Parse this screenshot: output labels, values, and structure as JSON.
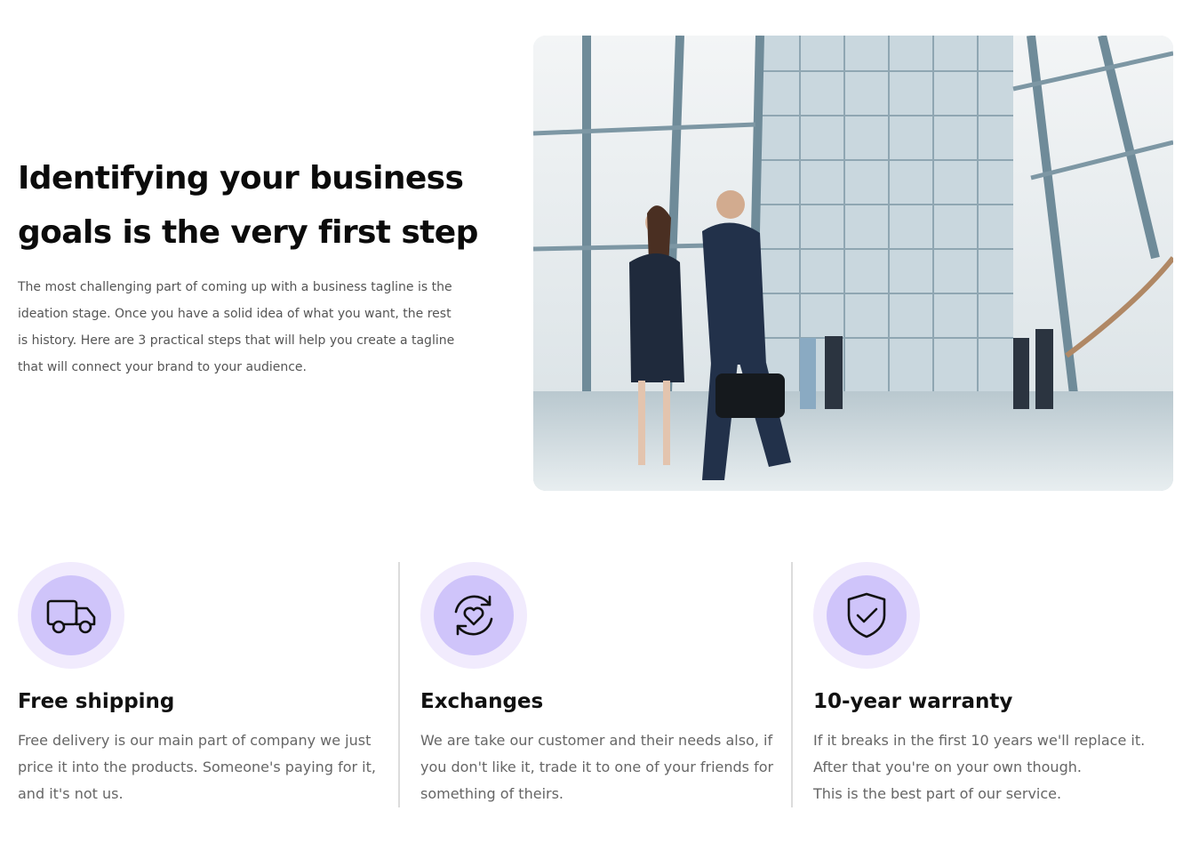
{
  "hero": {
    "title": "Identifying your business goals is the very first step",
    "body": "The most challenging part of coming up with a business tagline is the ideation stage. Once you have a solid idea of what you want, the rest is history. Here are 3 practical steps that will help you create a tagline that will connect your brand to your audience.",
    "image_icon": "office-people-walking-photo"
  },
  "features": [
    {
      "icon": "truck-icon",
      "title": "Free shipping",
      "body": "Free delivery is our main part of company we just price it into the products. Someone's paying for it, and it's not us."
    },
    {
      "icon": "exchange-heart-icon",
      "title": "Exchanges",
      "body": "We are take our customer and their needs also, if you don't like it, trade it to one of your friends for something of theirs."
    },
    {
      "icon": "shield-check-icon",
      "title": "10-year warranty",
      "body_line1": "If it breaks in the first 10 years we'll replace it. After that you're on your own though.",
      "body_line2": "This is the best part of our service."
    }
  ],
  "colors": {
    "icon_ring": "#f1ebfd",
    "icon_core": "#cfc4fa",
    "divider": "#dcdcdc"
  }
}
